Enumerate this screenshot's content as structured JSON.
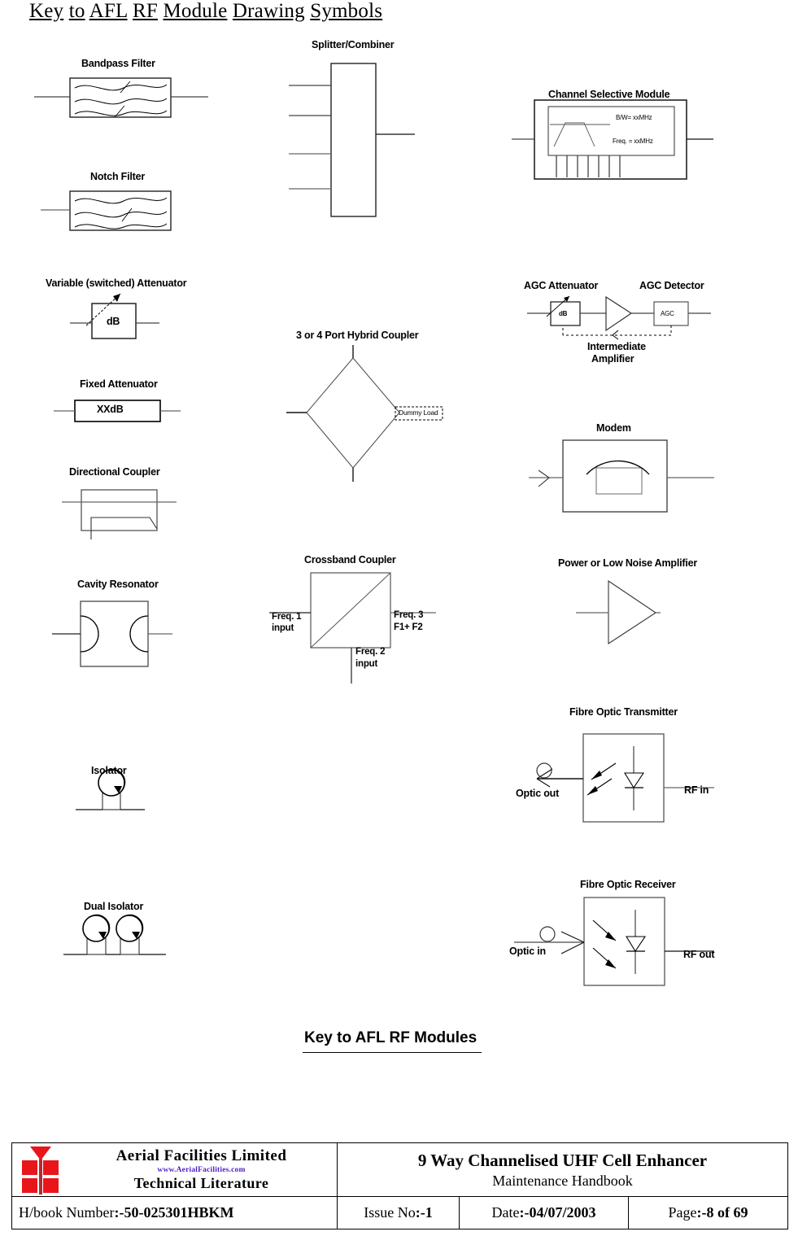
{
  "title": {
    "words": [
      "Key",
      "to",
      "AFL",
      "RF",
      "Module",
      "Drawing",
      "Symbols"
    ],
    "full": "Key to AFL RF Module Drawing Symbols"
  },
  "caption": {
    "text": "Key to AFL RF Modules"
  },
  "symbols": [
    {
      "id": "bandpass-filter",
      "label": "Bandpass Filter"
    },
    {
      "id": "notch-filter",
      "label": "Notch Filter"
    },
    {
      "id": "splitter-combiner",
      "label": "Splitter/Combiner"
    },
    {
      "id": "channel-selective-module",
      "label": "Channel Selective Module",
      "bw": "B/W= xxMHz",
      "freq": "Freq. = xxMHz"
    },
    {
      "id": "variable-attenuator",
      "label": "Variable (switched) Attenuator",
      "box_text": "dB"
    },
    {
      "id": "fixed-attenuator",
      "label": "Fixed Attenuator",
      "box_text": "XXdB"
    },
    {
      "id": "directional-coupler",
      "label": "Directional Coupler"
    },
    {
      "id": "cavity-resonator",
      "label": "Cavity Resonator"
    },
    {
      "id": "hybrid-coupler",
      "label": "3 or 4 Port Hybrid Coupler",
      "dummy_load": "Dummy Load"
    },
    {
      "id": "crossband-coupler",
      "label": "Crossband Coupler",
      "port1": "Freq. 1",
      "port1b": "input",
      "port3": "Freq. 3",
      "port3b": "F1+ F2",
      "port2": "Freq. 2",
      "port2b": "input"
    },
    {
      "id": "agc-attenuator",
      "label": "AGC Attenuator",
      "box_text": "dB"
    },
    {
      "id": "agc-detector",
      "label": "AGC Detector",
      "box_text": "AGC"
    },
    {
      "id": "intermediate-amplifier",
      "label": "Intermediate",
      "label2": "Amplifier"
    },
    {
      "id": "modem",
      "label": "Modem"
    },
    {
      "id": "power-amplifier",
      "label": "Power or Low Noise Amplifier"
    },
    {
      "id": "isolator",
      "label": "Isolator"
    },
    {
      "id": "dual-isolator",
      "label": "Dual Isolator"
    },
    {
      "id": "fibre-optic-transmitter",
      "label": "Fibre Optic Transmitter",
      "optic": "Optic out",
      "rf": "RF in"
    },
    {
      "id": "fibre-optic-receiver",
      "label": "Fibre Optic Receiver",
      "optic": "Optic in",
      "rf": "RF out"
    }
  ],
  "footer": {
    "company": "Aerial  Facilities  Limited",
    "website": "www.AerialFacilities.com",
    "division": "Technical Literature",
    "doc_title": "9 Way Channelised UHF Cell Enhancer",
    "doc_subtitle": "Maintenance Handbook",
    "hbook_label": "H/book Number",
    "hbook_value": ":-50-025301HBKM",
    "issue_label": "Issue No",
    "issue_value": ":-1",
    "date_label": "Date",
    "date_value": ":-04/07/2003",
    "page_label": "Page",
    "page_value": ":-8 of 69"
  },
  "colors": {
    "logo_red": "#e8161b",
    "logo_url": "#4b1ec4",
    "line": "#000000"
  }
}
